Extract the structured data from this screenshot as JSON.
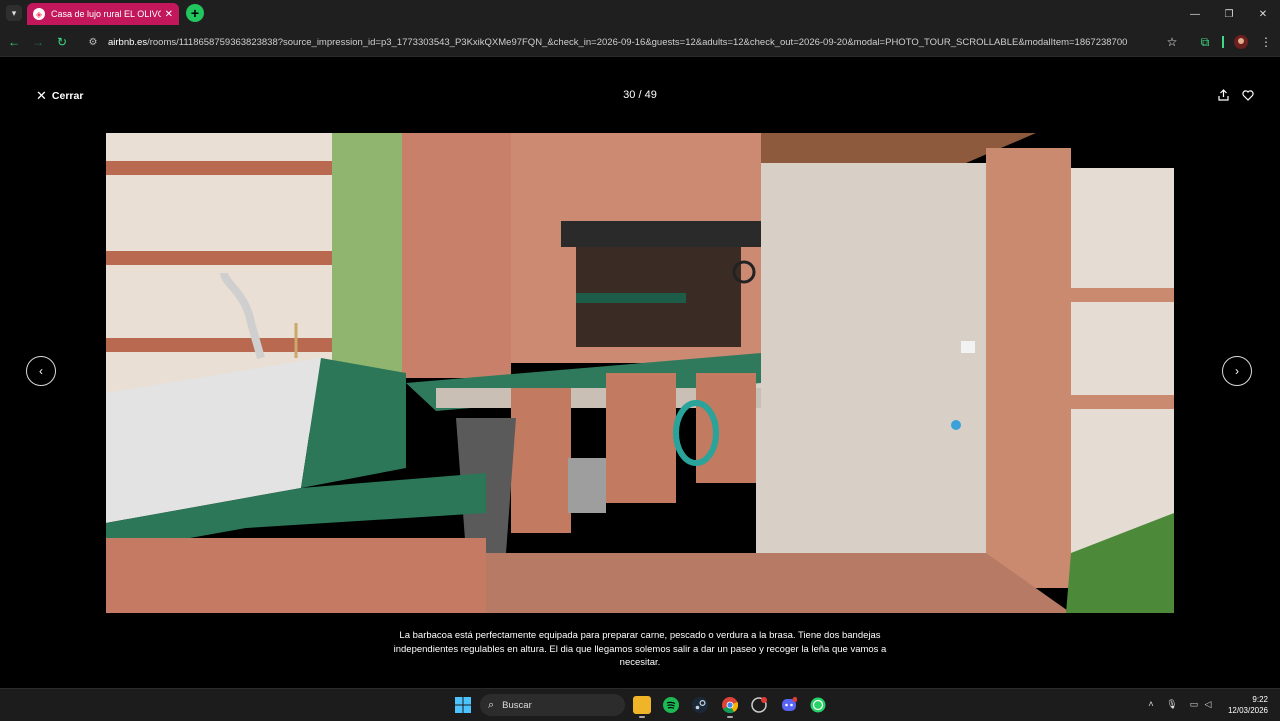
{
  "browser": {
    "tab_title": "Casa de lujo rural EL OLIVO - C",
    "tab_favicon_icon": "airbnb-icon",
    "url_host": "airbnb.es",
    "url_path": "/rooms/1118658759363823838?source_impression_id=p3_1773303543_P3KxikQXMe97FQN_&check_in=2026-09-16&guests=12&adults=12&check_out=2026-09-20&modal=PHOTO_TOUR_SCROLLABLE&modalItem=1867238700",
    "accent": "#3ddc84",
    "tab_color": "#c2185b"
  },
  "modal": {
    "close_label": "Cerrar",
    "counter": "30 / 49",
    "caption": "La barbacoa está perfectamente equipada para preparar carne, pescado o verdura a la brasa. Tiene dos bandejas independientes regulables en altura. El dia que llegamos solemos salir a dar un paseo y recoger la leña que vamos a necesitar."
  },
  "taskbar": {
    "search_placeholder": "Buscar",
    "time": "9:22",
    "date": "12/03/2026",
    "apps": [
      "windows-start-icon",
      "file-explorer-icon",
      "spotify-icon",
      "steam-icon",
      "chrome-icon",
      "app-icon",
      "discord-icon",
      "whatsapp-icon"
    ]
  }
}
